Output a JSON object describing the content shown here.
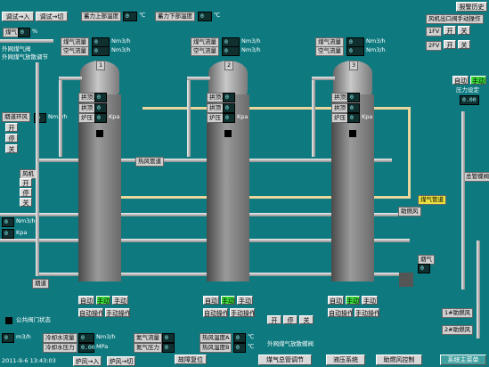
{
  "top_bar": {
    "debug_in": "调试→入",
    "debug_cut": "调试→切",
    "upper_temp_label": "蓄力上部温度",
    "upper_temp_value": "0",
    "lower_temp_label": "蓄力下部温度",
    "lower_temp_value": "0",
    "unit_c": "℃",
    "alarm_history": "报警历史"
  },
  "left_panel": {
    "gas_label": "煤气",
    "gas_value": "0",
    "unit_percent": "%",
    "outer_valve": "外网煤气阀",
    "outer_valve_adjust": "外网煤气放散调节",
    "ring_label": "烟道环风",
    "open": "开",
    "stop": "停",
    "close": "关",
    "flow_label": "流量",
    "pressure_label": "风压",
    "flow_value": "0",
    "flow_unit": "Nm3/h",
    "pressure_value": "0",
    "pressure_unit": "kPa",
    "fan_label": "风机",
    "fan_flow_value": "0",
    "fan_flow_unit": "Nm3/h",
    "fan_press_value": "0",
    "fan_press_unit": "Kpa"
  },
  "stoves": [
    {
      "number": "1",
      "gas_flow": "煤气流量",
      "air_flow": "空气流量",
      "gas_flow_value": "0",
      "air_flow_value": "0",
      "flow_unit": "Nm3/h",
      "vault_temp": "拱顶温度",
      "vault_value": "0",
      "dome": "拱顶",
      "dome_value": "0",
      "furnace_pressure": "炉压",
      "pressure_value": "0",
      "exhaust": "炉内",
      "exhaust_value": "0"
    },
    {
      "number": "2",
      "gas_flow": "煤气流量",
      "air_flow": "空气流量",
      "gas_flow_value": "0",
      "air_flow_value": "0",
      "flow_unit": "Nm3/h",
      "vault_temp": "拱顶温度",
      "vault_value": "0",
      "dome": "拱顶",
      "dome_value": "0",
      "furnace_pressure": "炉压",
      "pressure_value": "0",
      "exhaust": "炉内",
      "exhaust_value": "0"
    },
    {
      "number": "3",
      "gas_flow": "煤气流量",
      "air_flow": "空气流量",
      "gas_flow_value": "0",
      "air_flow_value": "0",
      "flow_unit": "Nm3/h",
      "vault_temp": "拱顶温度",
      "vault_value": "0",
      "dome": "拱顶",
      "dome_value": "0",
      "furnace_pressure": "炉压",
      "pressure_value": "0",
      "exhaust": "炉内",
      "exhaust_value": "0"
    }
  ],
  "right_panel": {
    "fan_outlet_valve": "风机出口阀手动操作",
    "fv1": "1FV",
    "fv2": "2FV",
    "open": "开",
    "close": "关",
    "auto": "自动",
    "manual": "手动",
    "pressure_setting": "压力设定",
    "pressure_setting_value": "0.00",
    "smoke": "烟气",
    "total_pipe": "总管蝶阀",
    "gas_pipe": "煤气管道",
    "switch_valve": "换向阀",
    "auxiliary_fan": "助燃风"
  },
  "labels": {
    "hot_air": "热风管道",
    "cold_air": "冷风管道",
    "gas_inlet": "煤气入口",
    "cold_valve": "冷风阀",
    "hot_valve": "热风阀",
    "flue_valve": "烟道阀",
    "mix_valve": "混风阀",
    "air_valve": "空气阀",
    "chimney": "烟囱",
    "kpa": "Kpa",
    "flue": "烟道",
    "public_valve": "公共阀门状态",
    "smoke_damper": "烟气",
    "bypass": "助燃风"
  },
  "controls": {
    "groups": [
      {
        "auto": "自动",
        "manual": "手动",
        "auto_op": "自动操作",
        "manual_op": "手动操作"
      },
      {
        "auto": "自动",
        "manual": "手动",
        "auto_op": "自动操作",
        "manual_op": "手动操作"
      },
      {
        "auto": "自动",
        "manual": "手动",
        "auto_op": "自动操作",
        "manual_op": "手动操作"
      }
    ],
    "open": "开",
    "stop": "停",
    "close": "关",
    "outer_valve_adjust": "外网煤气放散蝶阀"
  },
  "bottom_readouts": {
    "flow_value": "0",
    "flow_unit": "m3/h",
    "cool_flow": "冷却水流量",
    "cool_flow_value": "0",
    "cool_flow_unit": "Nm3/h",
    "cool_pressure": "冷却水压力",
    "cool_pressure_value": "0.00",
    "cool_pressure_unit": "MPa",
    "n2_flow": "氮气流量",
    "n2_flow_value": "0",
    "n2_pressure": "氮气压力",
    "n2_pressure_value": "0",
    "hot_temp_a": "热风温度A",
    "hot_temp_a_value": "0",
    "hot_temp_b": "热风温度B",
    "hot_temp_b_value": "0",
    "unit_c": "℃",
    "fault_reset": "故障复位",
    "unit_percent": "%",
    "small_val_a": "0",
    "small_val_b": "0"
  },
  "right_bottom": {
    "fan1": "1#助燃风",
    "fan2": "2#助燃风"
  },
  "footer": {
    "timestamp": "2011-9-6 13:43:03",
    "stove_in": "炉风→入",
    "stove_cut": "炉风→切",
    "gas_adjust": "煤气总管调节",
    "hydraulic": "液压系统",
    "combustion_fan": "助燃风控制",
    "main_menu": "系统主菜单"
  }
}
